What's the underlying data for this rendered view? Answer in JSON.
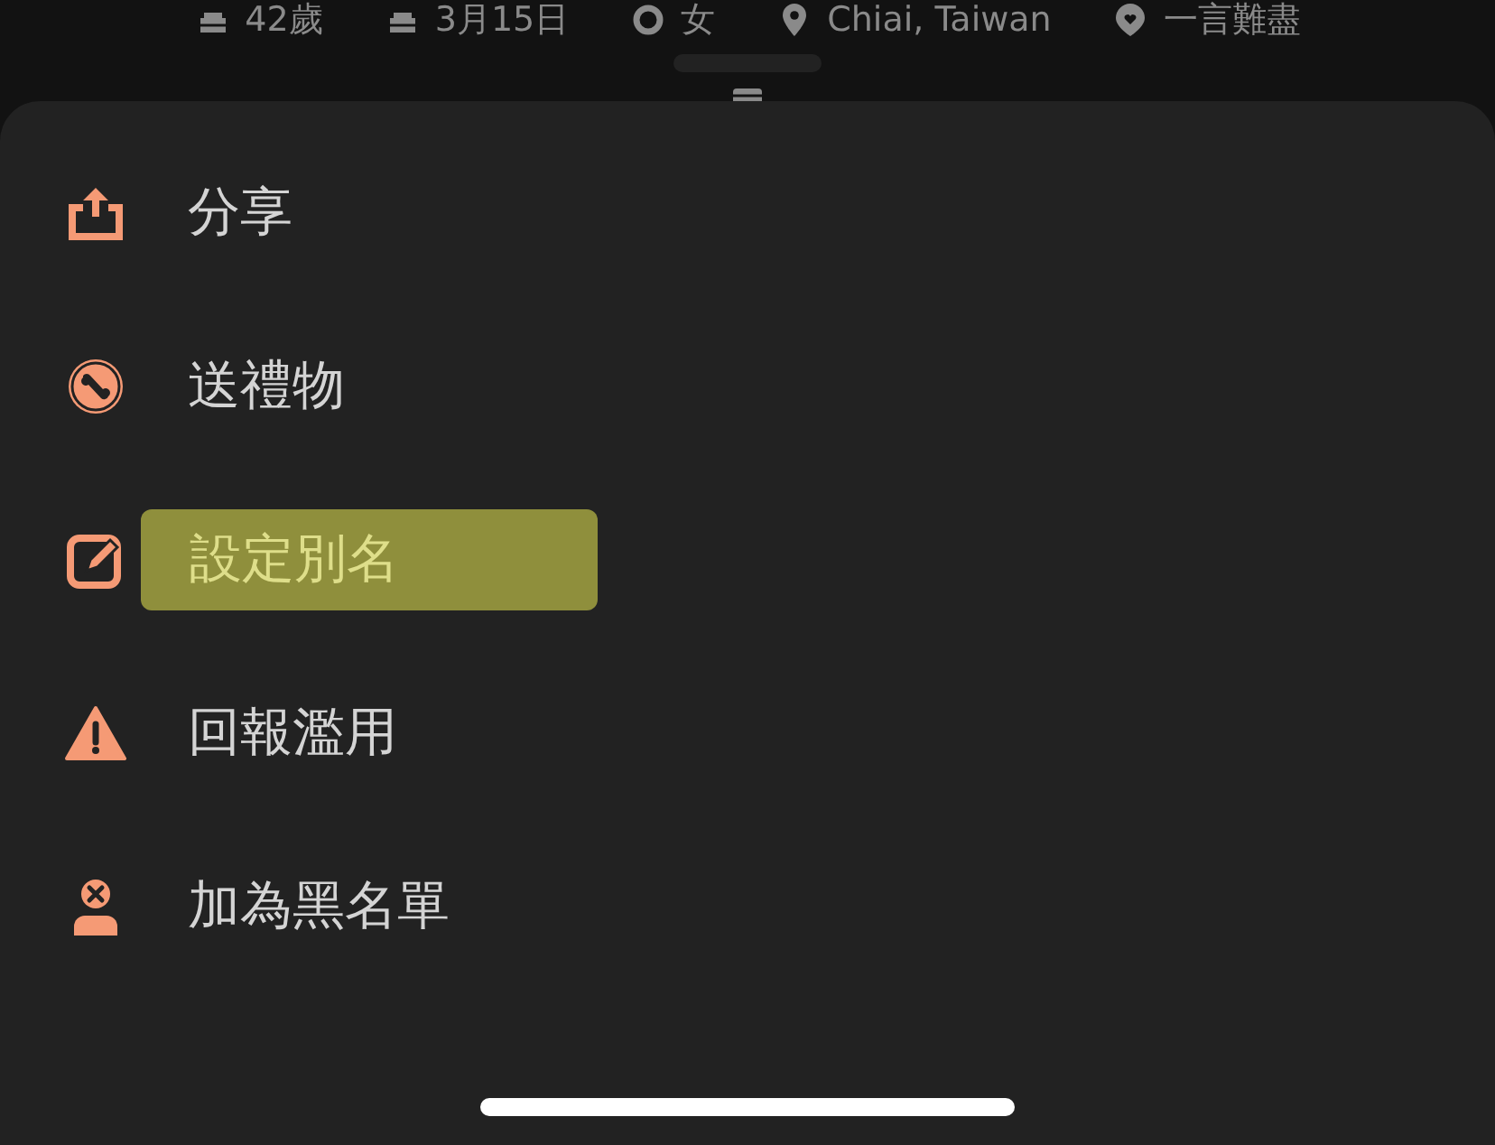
{
  "profile_info": [
    {
      "kind": "cake",
      "text": "42歲"
    },
    {
      "kind": "cake",
      "text": "3月15日"
    },
    {
      "kind": "gender",
      "text": "女"
    },
    {
      "kind": "pin",
      "text": "Chiai, Taiwan"
    },
    {
      "kind": "heart",
      "text": "一言難盡"
    }
  ],
  "menu": [
    {
      "kind": "share",
      "label": "分享",
      "highlighted": false
    },
    {
      "kind": "gift",
      "label": "送禮物",
      "highlighted": false
    },
    {
      "kind": "edit",
      "label": "設定別名",
      "highlighted": true
    },
    {
      "kind": "report",
      "label": "回報濫用",
      "highlighted": false
    },
    {
      "kind": "block",
      "label": "加為黑名單",
      "highlighted": false
    }
  ]
}
